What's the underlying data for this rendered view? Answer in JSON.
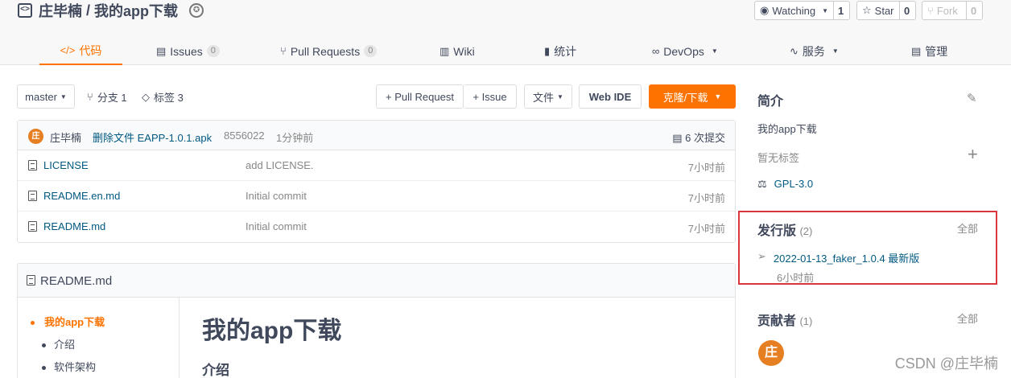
{
  "repo": {
    "owner": "庄毕楠",
    "separator": " / ",
    "name": "我的app下载",
    "watch_label": "Watching",
    "watch_count": "1",
    "star_label": "Star",
    "star_count": "0",
    "fork_label": "Fork",
    "fork_count": "0"
  },
  "tabs": [
    {
      "icon": "</>",
      "label": "代码",
      "count": ""
    },
    {
      "icon": "▤",
      "label": "Issues",
      "count": "0"
    },
    {
      "icon": "⑂",
      "label": "Pull Requests",
      "count": "0"
    },
    {
      "icon": "▥",
      "label": "Wiki",
      "count": ""
    },
    {
      "icon": "▮",
      "label": "统计",
      "count": ""
    },
    {
      "icon": "∞",
      "label": "DevOps",
      "count": ""
    },
    {
      "icon": "∿",
      "label": "服务",
      "count": ""
    },
    {
      "icon": "▤",
      "label": "管理",
      "count": ""
    }
  ],
  "toolbar": {
    "branch": "master",
    "branches_label": "分支 1",
    "tags_label": "标签 3",
    "pull_request": "+ Pull Request",
    "issue": "+ Issue",
    "file_menu": "文件",
    "web_ide": "Web IDE",
    "clone": "克隆/下载"
  },
  "commit": {
    "avatar_char": "庄",
    "author": "庄毕楠",
    "message": "删除文件 EAPP-1.0.1.apk",
    "hash": "8556022",
    "time": "1分钟前",
    "count_label": "6 次提交"
  },
  "files": [
    {
      "name": "LICENSE",
      "message": "add LICENSE.",
      "time": "7小时前"
    },
    {
      "name": "README.en.md",
      "message": "Initial commit",
      "time": "7小时前"
    },
    {
      "name": "README.md",
      "message": "Initial commit",
      "time": "7小时前"
    }
  ],
  "readme": {
    "filename": "README.md",
    "toc": [
      {
        "label": "我的app下载",
        "active": true
      },
      {
        "label": "介绍",
        "active": false
      },
      {
        "label": "软件架构",
        "active": false
      }
    ],
    "h1": "我的app下载",
    "h2": "介绍"
  },
  "sidebar": {
    "intro_title": "简介",
    "description": "我的app下载",
    "no_tags": "暂无标签",
    "license": "GPL-3.0",
    "releases_title": "发行版",
    "releases_count": "(2)",
    "releases_all": "全部",
    "release_name": "2022-01-13_faker_1.0.4 最新版",
    "release_time": "6小时前",
    "contributors_title": "贡献者",
    "contributors_count": "(1)",
    "contributors_all": "全部",
    "contributor_avatar": "庄"
  },
  "watermark": "CSDN @庄毕楠",
  "colors": {
    "accent": "#fe7300",
    "link": "#005980",
    "highlight_border": "#d9363e"
  }
}
